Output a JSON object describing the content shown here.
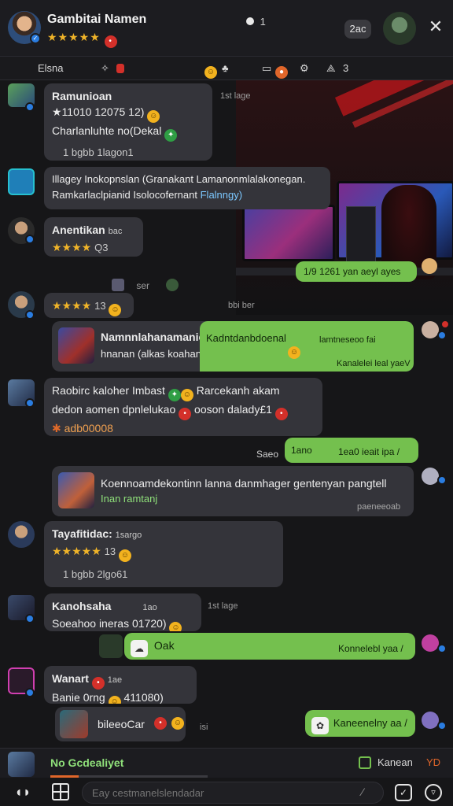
{
  "header": {
    "title": "Gambitai Namen",
    "stars": "★★★★★",
    "status": "1",
    "count": "2ac",
    "close_icon": "close-icon"
  },
  "toolbar": {
    "tab1": "Elsna",
    "tab2_count": "",
    "tab3_count": "3"
  },
  "messages": {
    "m1": {
      "name": "Ramunioan",
      "line2": "★11010 12075 12)",
      "line3": "Charlanluhte no(Dekal",
      "footer": "1 bgbb  1lagon1",
      "time": "1st lage"
    },
    "m2": {
      "line1": "Illagey Inokopnslan (Granakant Lamanonmlalakonegan.",
      "line2": "Ramkarlaclpianid Isolocofernant ",
      "link": "Flalnngy)"
    },
    "m3": {
      "name": "Anentikan",
      "tag": "bac",
      "stars": "★★★★",
      "meta": "Q3"
    },
    "m4": {
      "text": "1/9 1261 yan aeyl ayes"
    },
    "m5": {
      "center": "ser"
    },
    "m6": {
      "stars": "★★★★",
      "meta": "13",
      "time": "bbi ber"
    },
    "m7": {
      "name": "Namnnlahanamanio:",
      "line2": "hnanan (alkas koahanotar beloogo)",
      "green_head": "Kadntdanbdoenal",
      "green_time": "lamtneseoo fai",
      "green_foot": "Kanalelei leal yaeV"
    },
    "m8": {
      "line1": "Raobirc kaloher Imbast",
      "line1b": "Rarcekanh akam",
      "line2": "dedon aomen dpnlelukao",
      "line2b": "ooson dalady£1",
      "line3": "adb00008"
    },
    "m9": {
      "left": "Saeo",
      "text": "1ano",
      "time": "1ea0 ieait ipa /"
    },
    "m10": {
      "line1": "Koennoamdekontinn lanna danmhager gentenyan pangtell",
      "line2": "Inan ramtanj",
      "time": "paeneeoab"
    },
    "m11": {
      "name": "Tayafitidac:",
      "tag": "1sargo",
      "stars": "★★★★★",
      "meta": "13",
      "footer": "1 bgbb  2lgo61"
    },
    "m12": {
      "name": "Kanohsaha",
      "tag": "1ao",
      "line2": "Soeahoo ineras 01720)",
      "time": "1st lage"
    },
    "m13": {
      "text": "Oak",
      "time": "Konnelebl yaa /"
    },
    "m14": {
      "name": "Wanart",
      "tag": "1ae",
      "line2": "Banie 0rng",
      "line2b": "411080)"
    },
    "m15": {
      "text": "bileeoCar",
      "time": "isi"
    },
    "m16": {
      "text": "Kaneenelny aa /"
    }
  },
  "composer": {
    "left_text": "No Gcdealiyet",
    "right_text": "Kanean",
    "right_tag": "YD",
    "placeholder": "Eay cestmanelslendadar"
  },
  "colors": {
    "accent_green": "#74c04e",
    "bubble": "#34343a",
    "star": "#f0b429",
    "badge": "#2a7de1"
  }
}
